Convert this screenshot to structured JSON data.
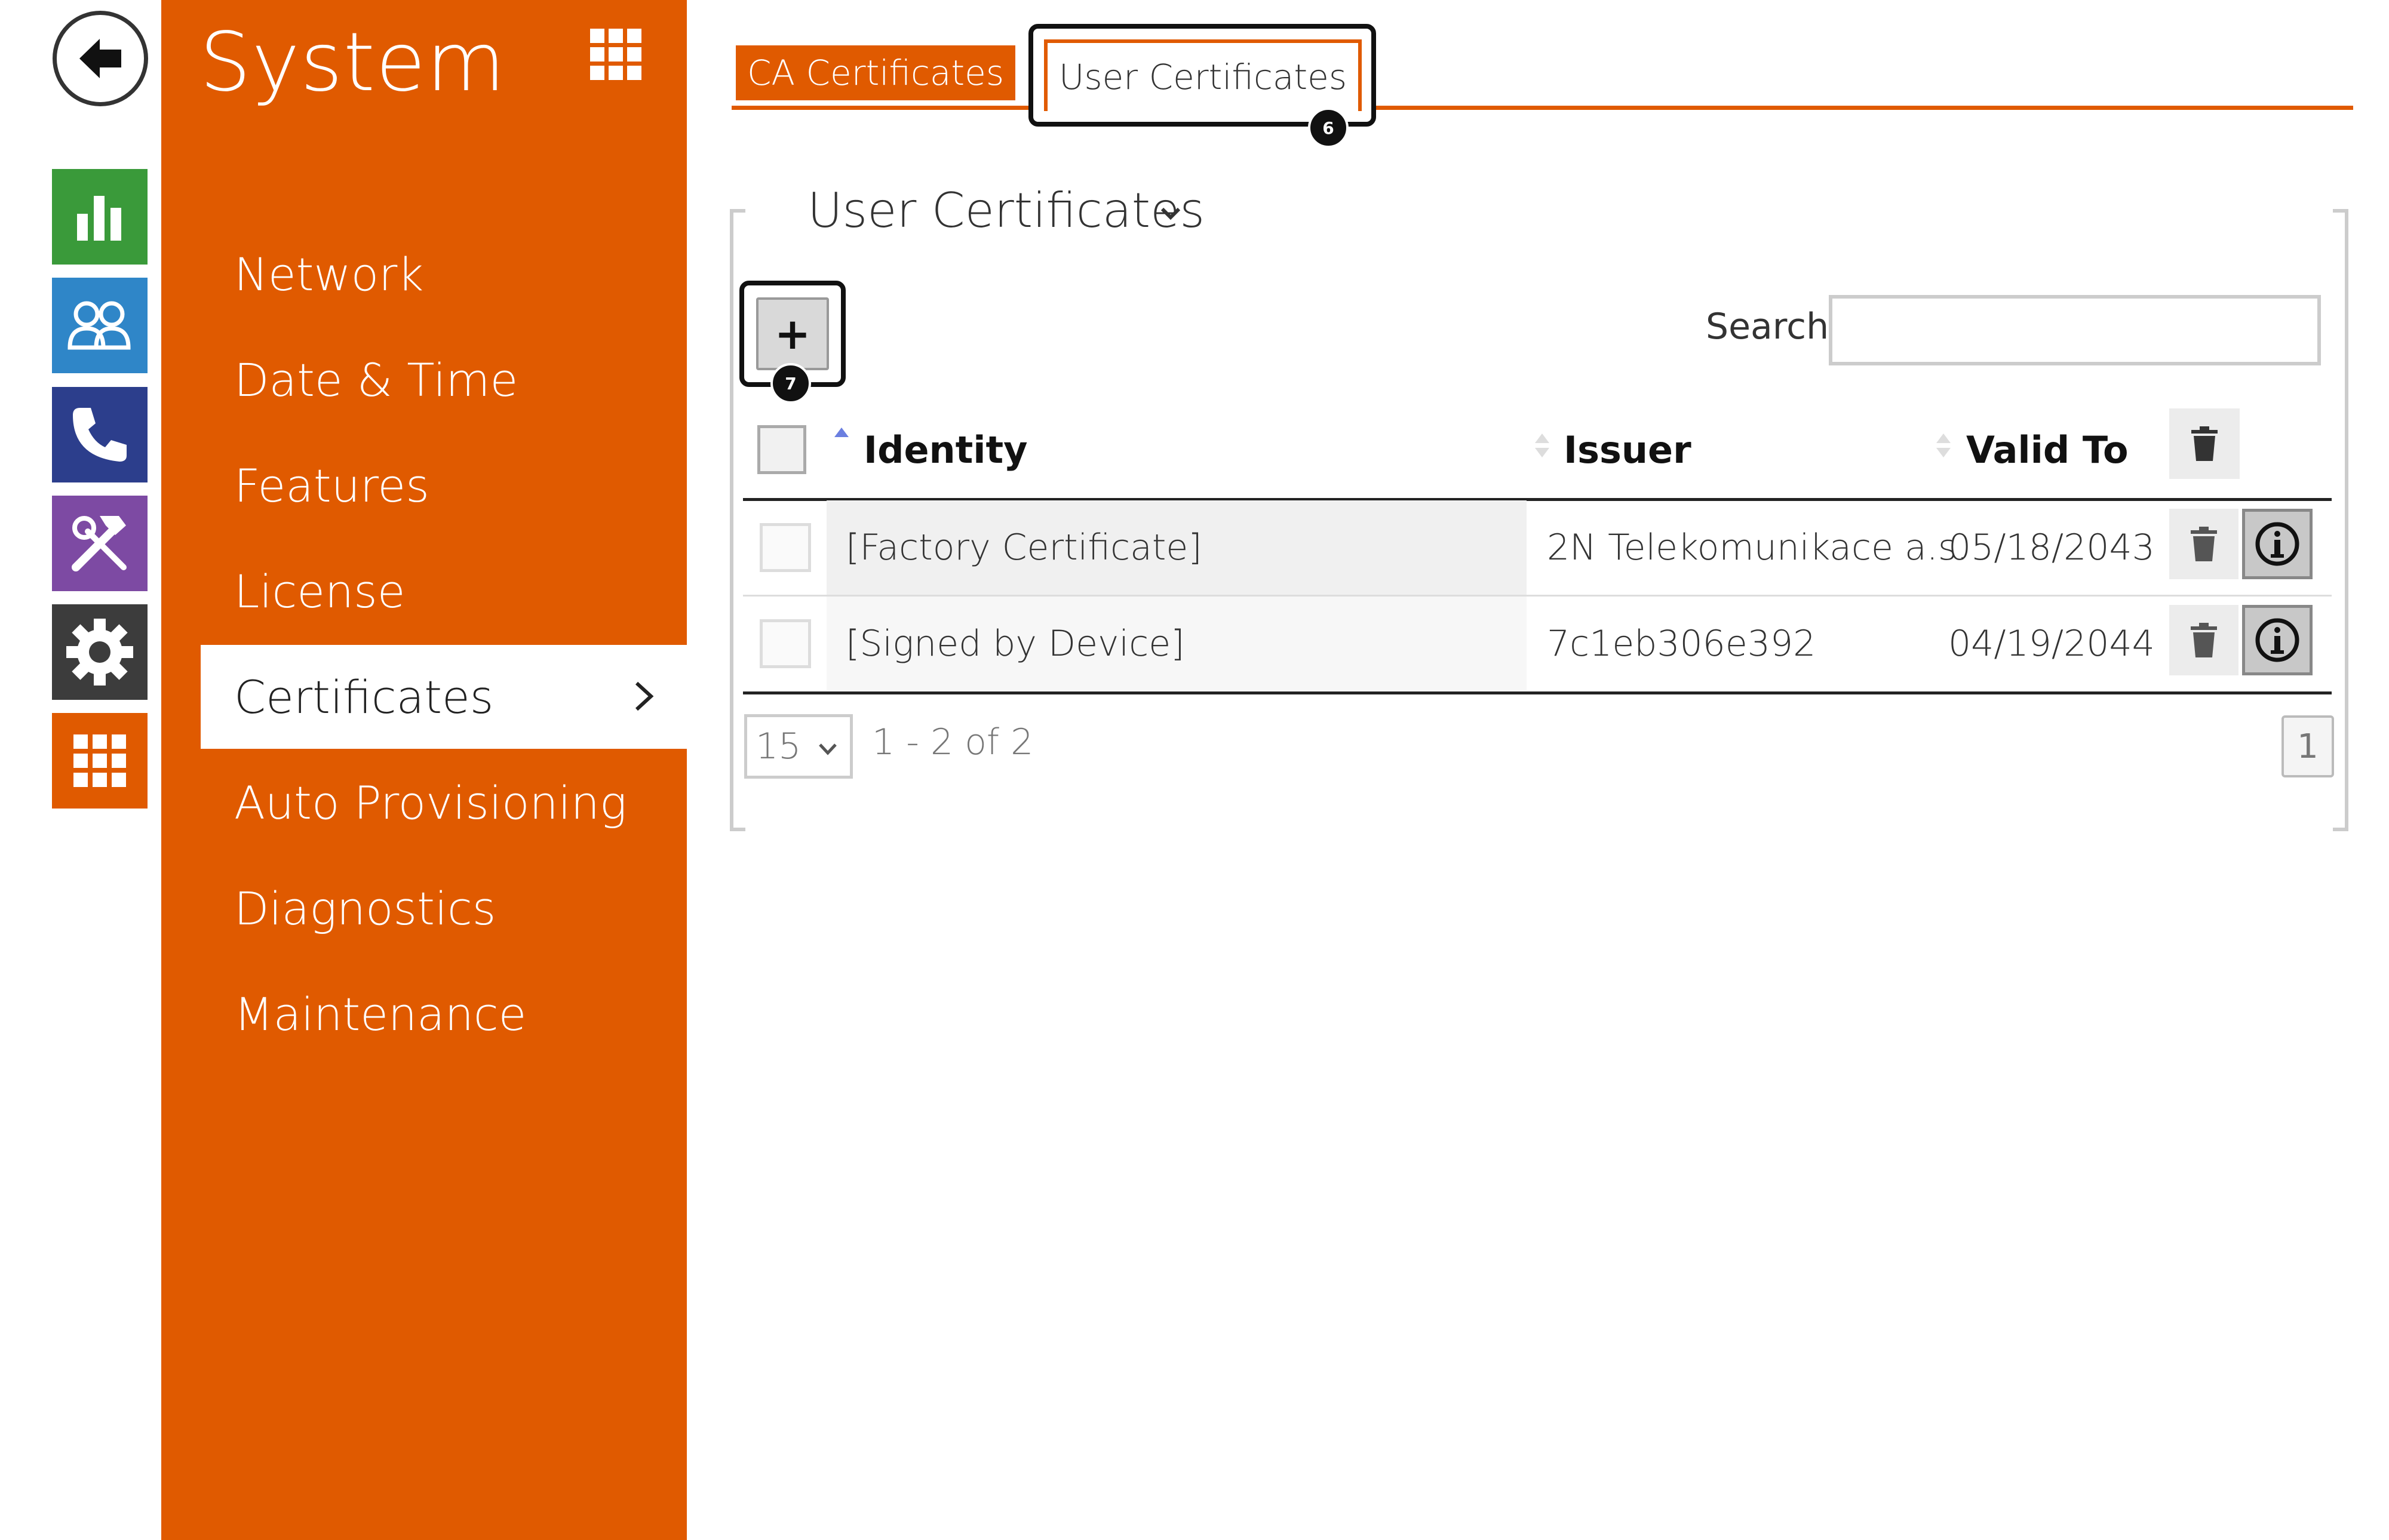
{
  "rail": {
    "back": "back-arrow-icon",
    "tiles": [
      {
        "icon": "bar-chart-icon",
        "color": "#3a9a3a"
      },
      {
        "icon": "users-icon",
        "color": "#2f86c8"
      },
      {
        "icon": "phone-icon",
        "color": "#2c3e8c"
      },
      {
        "icon": "tools-icon",
        "color": "#7d4aa3"
      },
      {
        "icon": "gear-icon",
        "color": "#3c3c3c"
      },
      {
        "icon": "grid-icon",
        "color": "#e05a00"
      }
    ]
  },
  "sidebar": {
    "title": "System",
    "items": [
      {
        "label": "Network"
      },
      {
        "label": "Date & Time"
      },
      {
        "label": "Features"
      },
      {
        "label": "License"
      },
      {
        "label": "Certificates",
        "active": true
      },
      {
        "label": "Auto Provisioning"
      },
      {
        "label": "Diagnostics"
      },
      {
        "label": "Maintenance"
      }
    ]
  },
  "tabs": [
    {
      "label": "CA Certificates"
    },
    {
      "label": "User Certificates",
      "active": true
    }
  ],
  "badges": {
    "tab": "6",
    "add": "7"
  },
  "section": {
    "title": "User Certificates",
    "add_label": "+"
  },
  "search": {
    "label": "Search",
    "value": ""
  },
  "table": {
    "columns": [
      "Identity",
      "Issuer",
      "Valid To"
    ],
    "sort": {
      "column": "Identity",
      "direction": "ascending"
    },
    "rows": [
      {
        "identity": "[Factory Certificate]",
        "issuer": "2N Telekomunikace a.s.",
        "valid_to": "05/18/2043"
      },
      {
        "identity": "[Signed by Device]",
        "issuer": "7c1eb306e392",
        "valid_to": "04/19/2044"
      }
    ]
  },
  "pagination": {
    "page_size": "15",
    "range": "1 - 2 of 2",
    "current_page": "1"
  },
  "colors": {
    "accent": "#e05a00",
    "sort_active": "#6b7fe0"
  }
}
